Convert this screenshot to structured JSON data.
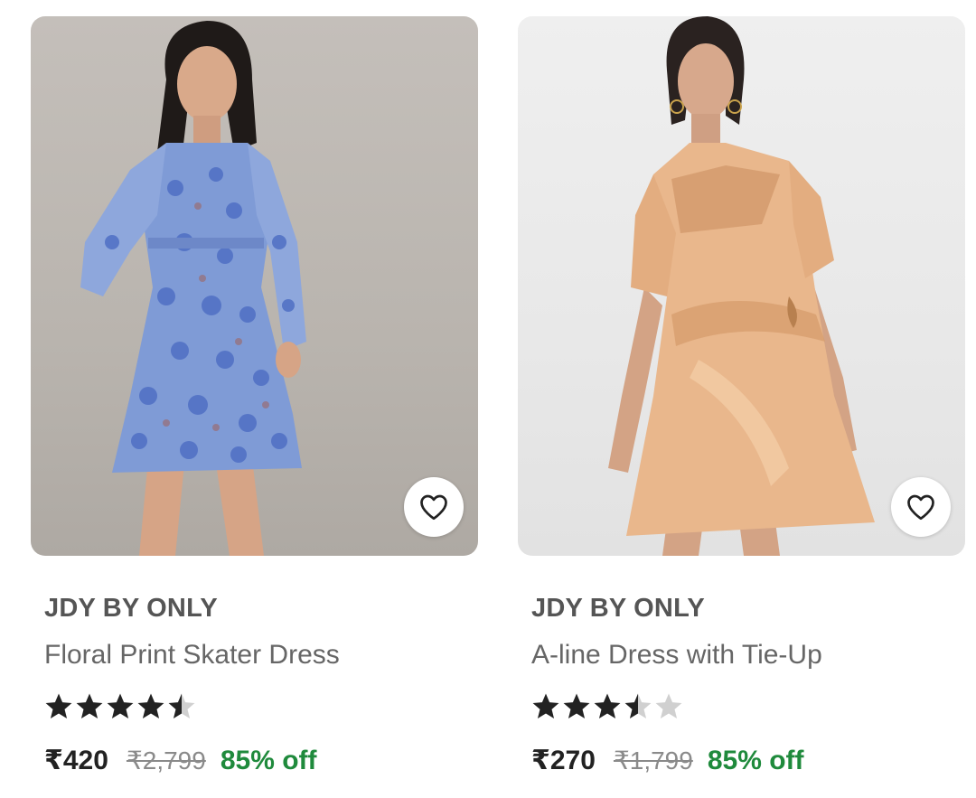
{
  "products": [
    {
      "brand": "JDY BY ONLY",
      "title": "Floral Print Skater Dress",
      "rating": 4.5,
      "price": "₹420",
      "mrp": "₹2,799",
      "discount": "85% off",
      "image": "woman-in-blue-floral-dress",
      "wishlist_icon": "heart-outline-icon"
    },
    {
      "brand": "JDY BY ONLY",
      "title": "A-line Dress with Tie-Up",
      "rating": 3.5,
      "price": "₹270",
      "mrp": "₹1,799",
      "discount": "85% off",
      "image": "woman-in-peach-satin-dress",
      "wishlist_icon": "heart-outline-icon"
    }
  ],
  "colors": {
    "star_filled": "#222222",
    "star_empty": "#d0d0d0",
    "discount": "#1f8a3c"
  }
}
